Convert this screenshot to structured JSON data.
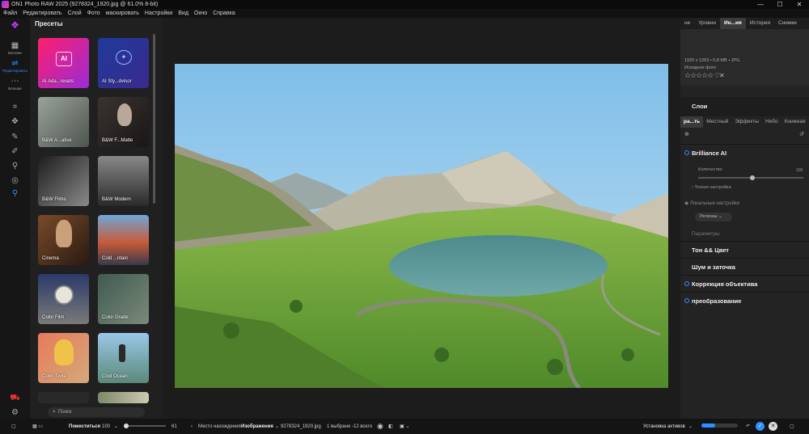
{
  "titlebar": {
    "title": "ON1 Photo RAW 2025 (9278324_1920.jpg @ 61.0% 8-bit)",
    "minimize": "—",
    "maximize": "☐",
    "close": "✕"
  },
  "menu": [
    "Файл",
    "Редактировать",
    "Слой",
    "Фото",
    "маскировать",
    "Настройки",
    "Вид",
    "Окно",
    "Справка"
  ],
  "rail": {
    "browse_label": "Взгляни",
    "edit_label": "Редактировать",
    "more_label": "Больше"
  },
  "presets": {
    "header": "Пресеты",
    "items": [
      {
        "label": "AI Ada...resets",
        "bg": "linear-gradient(135deg,#ff1f6d,#9a2bd6)"
      },
      {
        "label": "AI Sty...dvisor",
        "bg": "linear-gradient(135deg,#1e3a9a,#3b2a8f)"
      },
      {
        "label": "B&W A...ative",
        "bg": "linear-gradient(135deg,#9aa39a,#4d544f)"
      },
      {
        "label": "B&W F...Matte",
        "bg": "linear-gradient(135deg,#3a3330,#1a1716)"
      },
      {
        "label": "B&W Films",
        "bg": "linear-gradient(135deg,#1c1c1c,#8a8a8a)"
      },
      {
        "label": "B&W Modern",
        "bg": "linear-gradient(180deg,#888,#2a2a2a)"
      },
      {
        "label": "Cinema",
        "bg": "linear-gradient(135deg,#7a4a2a,#2a1a12)"
      },
      {
        "label": "Cold ...ntain",
        "bg": "linear-gradient(180deg,#6fa7d8,#c75a3a 55%,#3a3a4a)"
      },
      {
        "label": "Color Film",
        "bg": "linear-gradient(180deg,#2a3a6a,#7a7a78)"
      },
      {
        "label": "Color Grade",
        "bg": "linear-gradient(135deg,#3f5a50,#7a8a7a)"
      },
      {
        "label": "Color Twist",
        "bg": "linear-gradient(135deg,#e87a5a,#d4a97a)"
      },
      {
        "label": "Cool Ocean",
        "bg": "linear-gradient(180deg,#9ac7e8,#5a8a7a)"
      }
    ],
    "search_placeholder": "Поиск"
  },
  "right": {
    "tabs": [
      "не",
      "Уровни",
      "Ин...ия",
      "История",
      "Снимки"
    ],
    "active_tab": "Ин...ия",
    "info_line": "1920 x 1263 • 0,8 MB • JPG",
    "source_label": "Исходное фото",
    "layers_title": "Слои",
    "layer_tabs": [
      "ра...ть",
      "Местный",
      "Эффекты",
      "Небо",
      "Книжная"
    ],
    "brilliance_title": "Brilliance AI",
    "amount_label": "Количество",
    "amount_value": "100",
    "fine_tune": "Тонкая настройка",
    "local_settings": "Локальные настройки",
    "regions": "Регионы",
    "params_label": "Параметры",
    "sections": [
      "Тон && Цвет",
      "Шум и заточка",
      "Коррекция объектива",
      "преобразование"
    ]
  },
  "bottom": {
    "fit_label": "Поместиться",
    "zoom_value": "100",
    "slider_value": "61",
    "location_label": "Место нахождения",
    "location_folder": "Изображения",
    "filename": "9278324_1920.jpg",
    "selected": "1 выбрано -12 всего",
    "asset_setting": "Установка активов"
  },
  "colors": {
    "accent": "#2f8fff",
    "panel": "#202021"
  }
}
